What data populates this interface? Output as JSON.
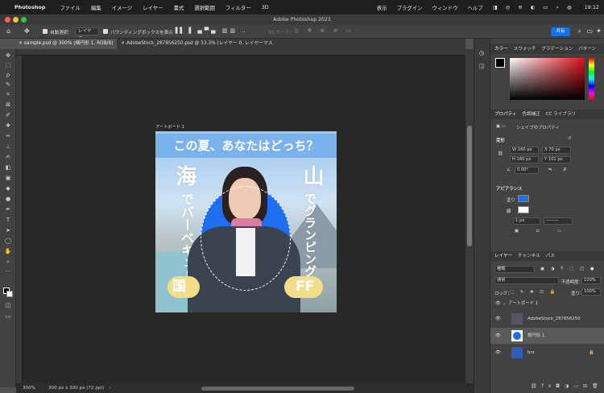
{
  "menubar": {
    "apple": "",
    "app": "Photoshop",
    "items": [
      "ファイル",
      "編集",
      "イメージ",
      "レイヤー",
      "書式",
      "選択範囲",
      "フィルター",
      "3D"
    ],
    "right_items": [
      "表示",
      "プラグイン",
      "ウィンドウ",
      "ヘルプ"
    ],
    "clock": "19:12"
  },
  "window": {
    "title": "Adobe Photoshop 2023"
  },
  "options_bar": {
    "auto_select_label": "自動選択：",
    "layer_dropdown": "レイヤー",
    "bbox_label": "バウンディングボックスを表示",
    "mode_3d": "3D モード：",
    "share_label": "共有"
  },
  "tabs": [
    {
      "label": "sample.psd @ 300% (楕円形 1, RGB/8)",
      "active": true
    },
    {
      "label": "AdobeStock_287856250.psd @ 33.3% (レイヤー 0, レイヤーマスク/8)",
      "active": false
    }
  ],
  "artboard": {
    "label": "アートボード 1",
    "headline": "この夏、あなたはどっち？",
    "left_big": "海",
    "left_small": "でバーベキュー",
    "right_big": "山",
    "right_small": "でグランピング",
    "left_button": "国",
    "right_button": "FF"
  },
  "status": {
    "zoom": "300%",
    "size": "300 px x 300 px (72 ppi)",
    "arrow": "›"
  },
  "color_panel": {
    "tabs": [
      "カラー",
      "スウォッチ",
      "グラデーション",
      "パターン"
    ]
  },
  "properties_panel": {
    "tabs": [
      "プロパティ",
      "色調補正",
      "CC ライブラリ"
    ],
    "shape_props": "シェイプのプロパティ",
    "transform_label": "変形",
    "w": "W  160 px",
    "x": "X  70 px",
    "h": "H  160 px",
    "y": "Y  101 px",
    "angle": "0.00°",
    "appearance_label": "アピアランス",
    "fill_label": "塗り",
    "stroke_label": "線",
    "stroke_width": "1 px",
    "fill_color": "#1e6ff0"
  },
  "layers_panel": {
    "tabs": [
      "レイヤー",
      "チャンネル",
      "パス"
    ],
    "filter": "種類",
    "blend_mode": "通常",
    "opacity_label": "不透明度：",
    "opacity": "100%",
    "lock_label": "ロック：",
    "fill_label": "塗り：",
    "fill": "100%",
    "group": "アートボード 1",
    "layers": [
      {
        "name": "AdobeStock_287856250"
      },
      {
        "name": "楕円形 1"
      },
      {
        "name": "bnr"
      }
    ],
    "footer_icons": [
      "link-icon",
      "fx-icon",
      "mask-icon",
      "adjustment-icon",
      "folder-icon",
      "new-layer-icon",
      "trash-icon"
    ]
  }
}
